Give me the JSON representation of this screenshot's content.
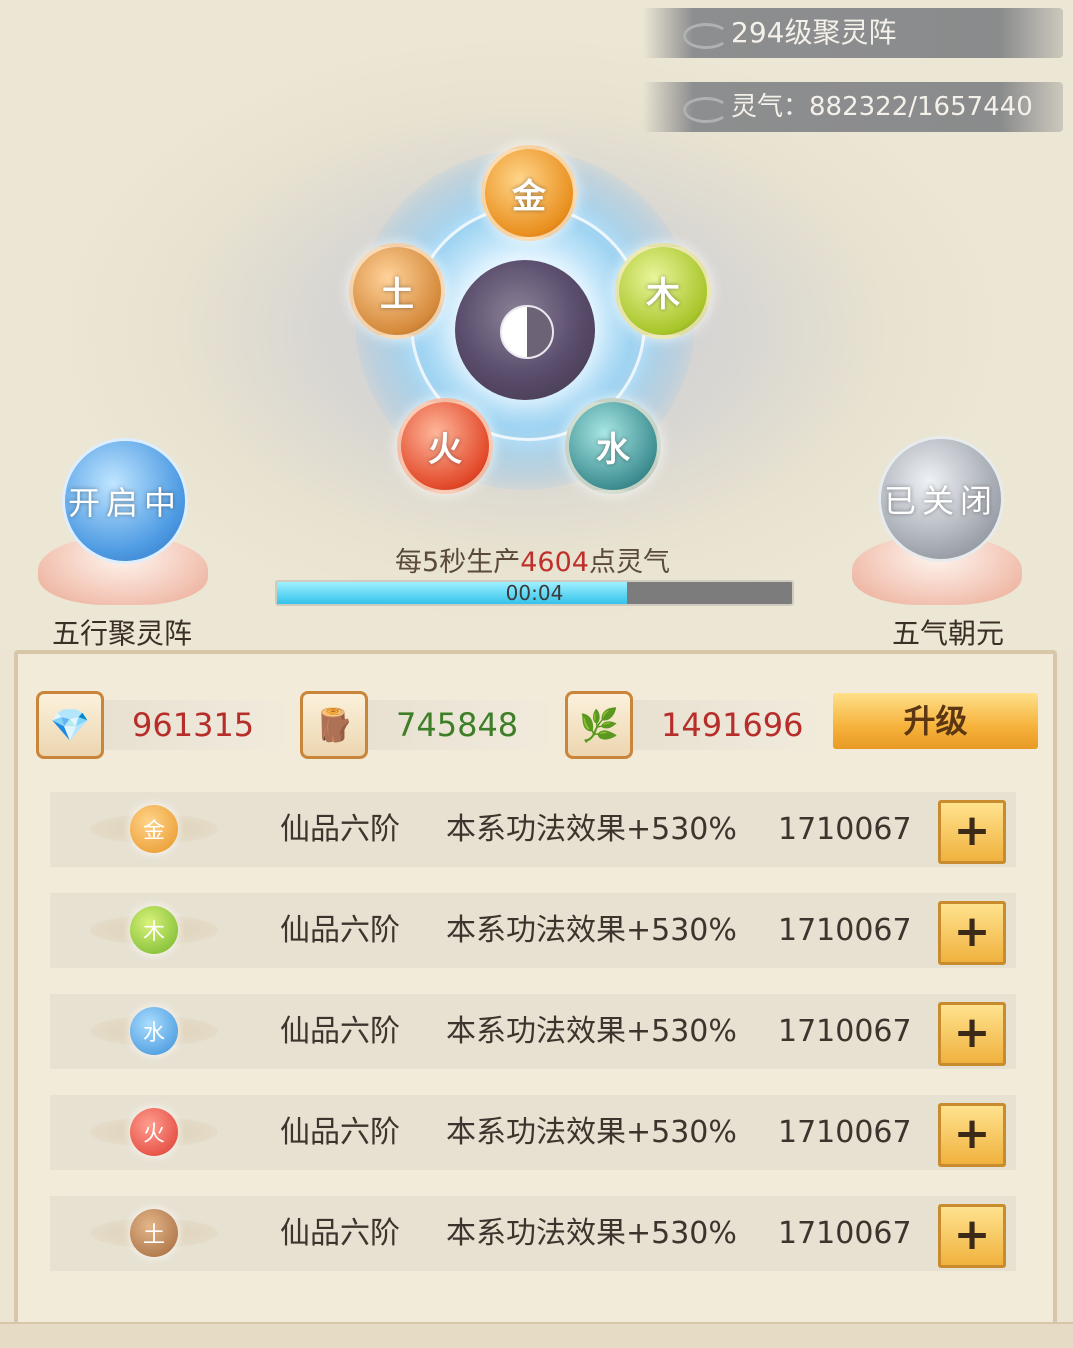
{
  "header": {
    "title": "294级聚灵阵",
    "qi": "灵气：882322/1657440"
  },
  "array": {
    "elements": [
      "金",
      "木",
      "水",
      "火",
      "土"
    ]
  },
  "left_button": {
    "status": "开启中",
    "label": "五行聚灵阵"
  },
  "right_button": {
    "status": "已关闭",
    "label": "五气朝元"
  },
  "production": {
    "prefix": "每5秒生产",
    "amount": "4604",
    "suffix": "点灵气",
    "timer": "00:04",
    "progress": 0.68
  },
  "resources": [
    {
      "icon": "crystal-icon",
      "value": "961315",
      "color": "#b72d2a"
    },
    {
      "icon": "wood-logs-icon",
      "value": "745848",
      "color": "#3f7e28"
    },
    {
      "icon": "herb-icon",
      "value": "1491696",
      "color": "#b72d2a"
    }
  ],
  "upgrade_label": "升级",
  "rows": [
    {
      "element": "金",
      "grade": "仙品六阶",
      "effect": "本系功法效果+530%",
      "cost": "1710067"
    },
    {
      "element": "木",
      "grade": "仙品六阶",
      "effect": "本系功法效果+530%",
      "cost": "1710067"
    },
    {
      "element": "水",
      "grade": "仙品六阶",
      "effect": "本系功法效果+530%",
      "cost": "1710067"
    },
    {
      "element": "火",
      "grade": "仙品六阶",
      "effect": "本系功法效果+530%",
      "cost": "1710067"
    },
    {
      "element": "土",
      "grade": "仙品六阶",
      "effect": "本系功法效果+530%",
      "cost": "1710067"
    }
  ],
  "plus_label": "+"
}
